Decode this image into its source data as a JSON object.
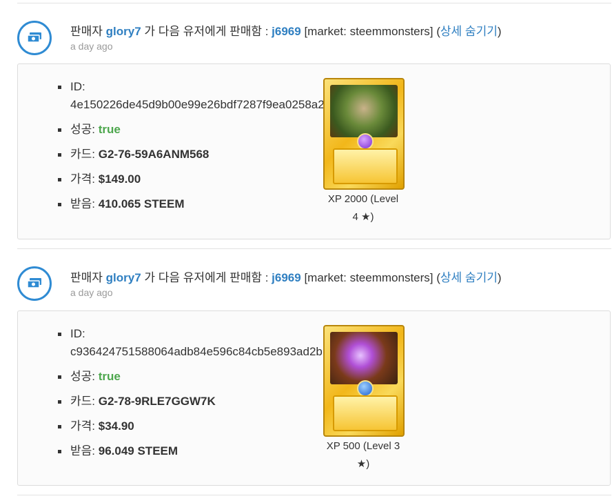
{
  "entries": [
    {
      "prefix": "판매자",
      "seller": "glory7",
      "middle": "가 다음 유저에게 판매함 :",
      "buyer": "j6969",
      "market": "[market: steemmonsters]",
      "paren_open": "(",
      "toggle": "상세 숨기기",
      "paren_close": ")",
      "time": "a day ago",
      "id_label": "ID:",
      "id_value": "4e150226de45d9b00e99e26bdf7287f9ea0258a2",
      "success_label": "성공:",
      "success_value": "true",
      "card_label": "카드:",
      "card_value": "G2-76-59A6ANM568",
      "price_label": "가격:",
      "price_value": "$149.00",
      "received_label": "받음:",
      "received_value": "410.065 STEEM",
      "caption_line1": "XP 2000 (Level",
      "caption_line2": "4 ★)"
    },
    {
      "prefix": "판매자",
      "seller": "glory7",
      "middle": "가 다음 유저에게 판매함 :",
      "buyer": "j6969",
      "market": "[market: steemmonsters]",
      "paren_open": "(",
      "toggle": "상세 숨기기",
      "paren_close": ")",
      "time": "a day ago",
      "id_label": "ID:",
      "id_value": "c936424751588064adb84e596c84cb5e893ad2bb",
      "success_label": "성공:",
      "success_value": "true",
      "card_label": "카드:",
      "card_value": "G2-78-9RLE7GGW7K",
      "price_label": "가격:",
      "price_value": "$34.90",
      "received_label": "받음:",
      "received_value": "96.049 STEEM",
      "caption_line1": "XP 500 (Level 3",
      "caption_line2": "★)"
    }
  ],
  "colors": {
    "accent": "#2f8bd3",
    "link": "#2f7fc1",
    "success": "#4ca64c",
    "card_gold": "#f2b71a"
  },
  "icons": [
    "money-icon"
  ]
}
